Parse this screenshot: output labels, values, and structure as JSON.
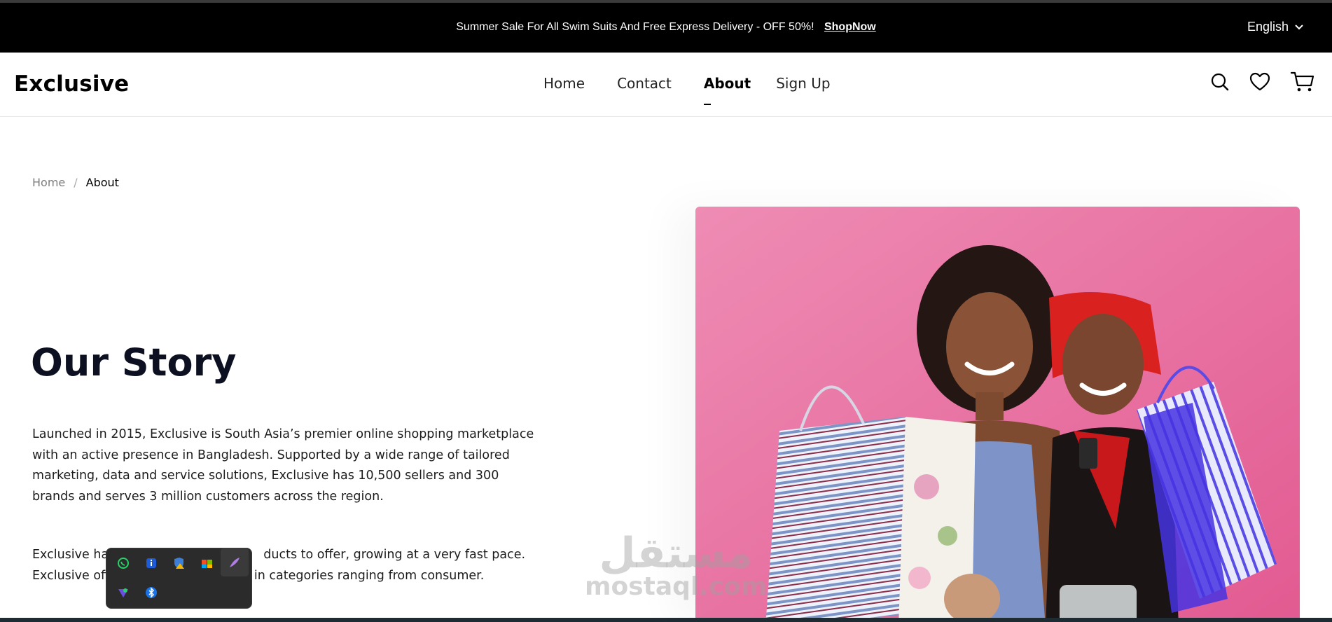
{
  "announcement": {
    "text": "Summer Sale For All Swim Suits And Free Express Delivery - OFF 50%!",
    "cta": "ShopNow",
    "language": "English"
  },
  "header": {
    "logo": "Exclusive",
    "nav": [
      {
        "label": "Home"
      },
      {
        "label": "Contact"
      },
      {
        "label": "About"
      },
      {
        "label": "Sign Up"
      }
    ],
    "active_nav": "About",
    "icons": [
      "search-icon",
      "heart-icon",
      "cart-icon"
    ]
  },
  "breadcrumb": {
    "home": "Home",
    "separator": "/",
    "current": "About"
  },
  "story": {
    "title": "Our Story",
    "paragraph1": "Launched in 2015, Exclusive is South Asia’s premier online shopping marketplace with an active presence in Bangladesh. Supported by a wide range of tailored marketing, data and service solutions, Exclusive has 10,500 sellers and 300 brands and serves 3 million customers across the region.",
    "paragraph2_line1_start": "Exclusive has",
    "paragraph2_line1_end": "ducts to offer, growing at a very fast pace.",
    "paragraph2_line2_start": "Exclusive offe",
    "paragraph2_line2_end": "in categories ranging from consumer."
  },
  "watermark": {
    "arabic": "مستقل",
    "latin": "mostaql.com"
  },
  "tray_icons": [
    "whatsapp-icon",
    "info-icon",
    "security-warning-icon",
    "cloud-icon",
    "pen-icon",
    "vpn-icon",
    "bluetooth-icon"
  ],
  "colors": {
    "announce_bg": "#000000",
    "hero_bg": "#e56b9b",
    "title": "#0c1020"
  }
}
